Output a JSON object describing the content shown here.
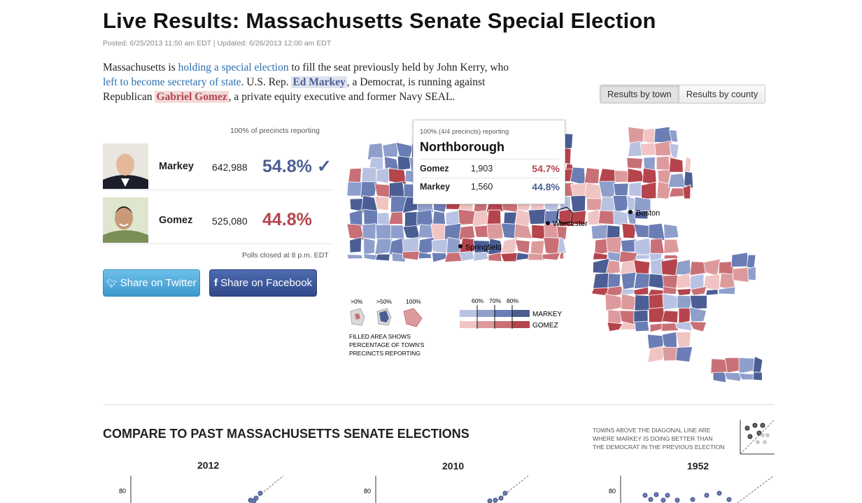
{
  "header": {
    "title": "Live Results: Massachusetts Senate Special Election",
    "meta": "Posted: 6/25/2013 11:50 am EDT | Updated: 6/26/2013 12:00 am EDT"
  },
  "intro": {
    "t1": "Massachusetts is ",
    "link1": "holding a special election",
    "t2": " to fill the seat previously held by John Kerry, who ",
    "link2": "left to become secretary of state",
    "t3": ". U.S. Rep. ",
    "markey": "Ed Markey",
    "t4": ", a Democrat, is running against Republican ",
    "gomez": "Gabriel Gomez",
    "t5": ", a private equity executive and former Navy SEAL."
  },
  "toggle": {
    "by_town": "Results by town",
    "by_county": "Results by county"
  },
  "results": {
    "reporting": "100% of precincts reporting",
    "candidates": [
      {
        "name": "Markey",
        "votes": "642,988",
        "pct": "54.8% ✓",
        "color": "#4b5e94"
      },
      {
        "name": "Gomez",
        "votes": "525,080",
        "pct": "44.8%",
        "color": "#b5444d"
      }
    ],
    "polls_closed": "Polls closed at 8 p.m. EDT"
  },
  "share": {
    "twitter": "Share on Twitter",
    "facebook": "Share on Facebook"
  },
  "tooltip": {
    "reporting": "100% (4/4 precincts) reporting",
    "town": "Northborough",
    "rows": [
      {
        "name": "Gomez",
        "votes": "1,903",
        "pct": "54.7%"
      },
      {
        "name": "Markey",
        "votes": "1,560",
        "pct": "44.8%"
      }
    ]
  },
  "map": {
    "cities": {
      "boston": "Boston",
      "worcester": "Worcester",
      "springfield": "Springfield"
    },
    "legend": {
      "pct0": ">0%",
      "pct50": ">50%",
      "pct100": "100%",
      "note": [
        "FILLED AREA SHOWS",
        "PERCENTAGE OF TOWN'S",
        "PRECINCTS REPORTING"
      ],
      "scale": [
        "60%",
        "70%",
        "80%"
      ],
      "markey": "MARKEY",
      "gomez": "GOMEZ"
    },
    "colors": {
      "markey": [
        "#b8c3e3",
        "#8f9fcc",
        "#6b7db5",
        "#4b5e94"
      ],
      "gomez": [
        "#f1c4c4",
        "#dd9a9d",
        "#c97076",
        "#b5444d"
      ]
    }
  },
  "compare": {
    "title": "COMPARE TO PAST MASSACHUSETTS SENATE ELECTIONS",
    "note": "TOWNS ABOVE THE DIAGONAL LINE ARE WHERE MARKEY IS DOING BETTER THAN THE DEMOCRAT IN THE PREVIOUS ELECTION",
    "charts": [
      {
        "year": "2012",
        "ytick": "80"
      },
      {
        "year": "2010",
        "ytick": "80"
      },
      {
        "year": "1952",
        "ytick": "80"
      }
    ]
  }
}
